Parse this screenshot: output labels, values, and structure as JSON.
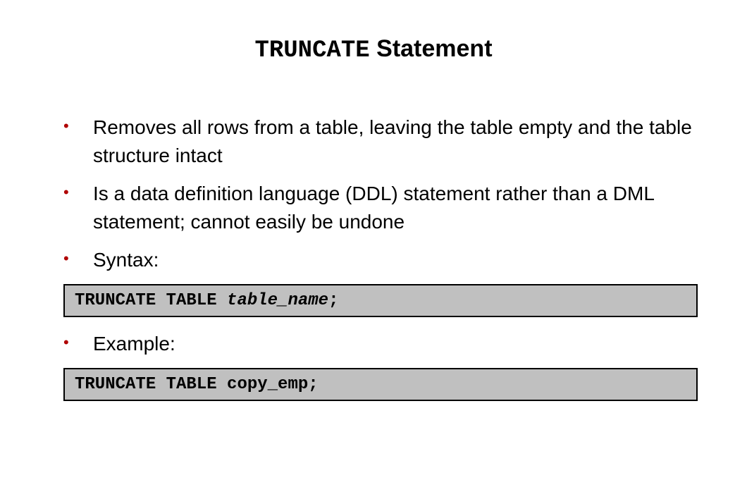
{
  "title": {
    "code_part": "TRUNCATE",
    "text_part": " Statement"
  },
  "bullets": [
    "Removes all rows from a table, leaving the table empty and the table structure intact",
    "Is a data definition language (DDL) statement rather than a DML statement; cannot easily be undone",
    "Syntax:",
    "Example:"
  ],
  "codeboxes": {
    "syntax": {
      "prefix": "TRUNCATE TABLE ",
      "italic": "table_name",
      "suffix": ";"
    },
    "example": {
      "text": "TRUNCATE TABLE copy_emp;"
    }
  }
}
